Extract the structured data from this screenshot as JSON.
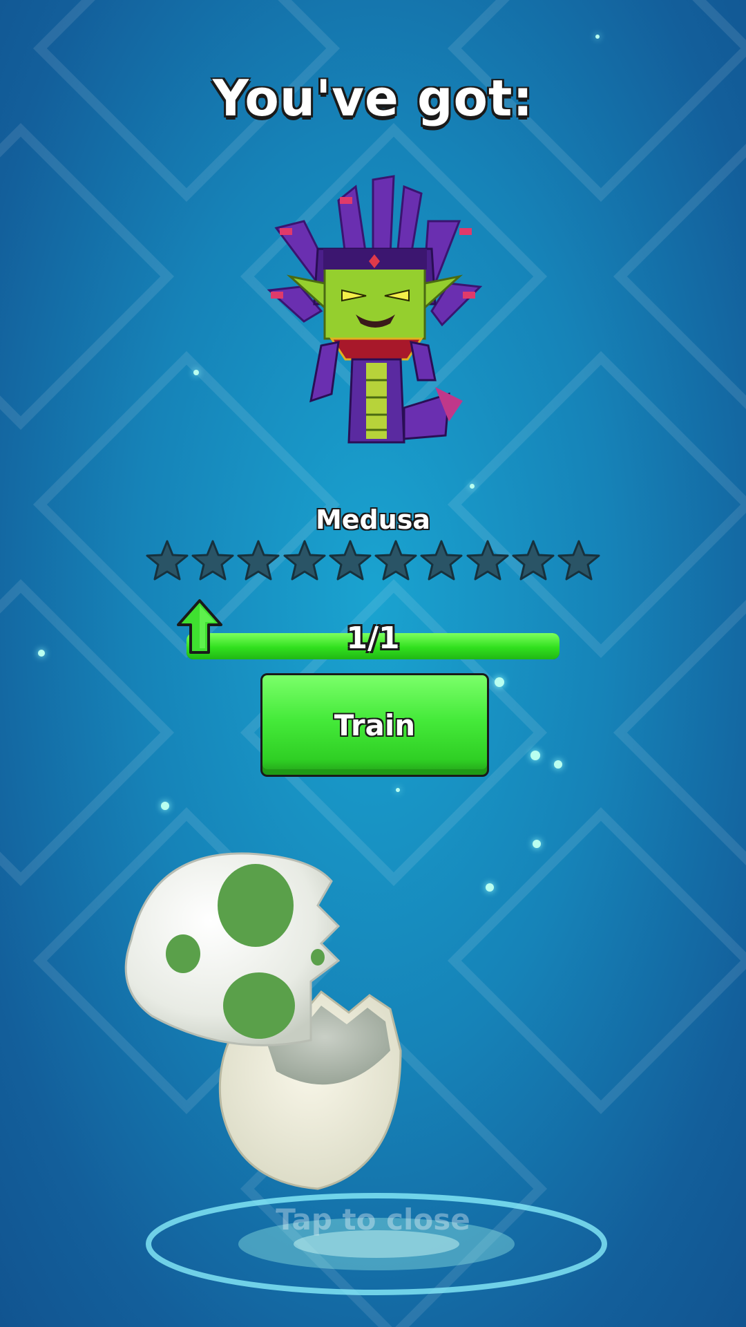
{
  "header": {
    "title": "You've got:"
  },
  "reward": {
    "name": "Medusa",
    "stars_total": 10,
    "stars_filled": 0,
    "progress_text": "1/1",
    "progress_fraction": 1.0
  },
  "actions": {
    "train_label": "Train",
    "close_hint": "Tap to close"
  },
  "colors": {
    "accent_green": "#34e024",
    "background": "#1683b8"
  }
}
